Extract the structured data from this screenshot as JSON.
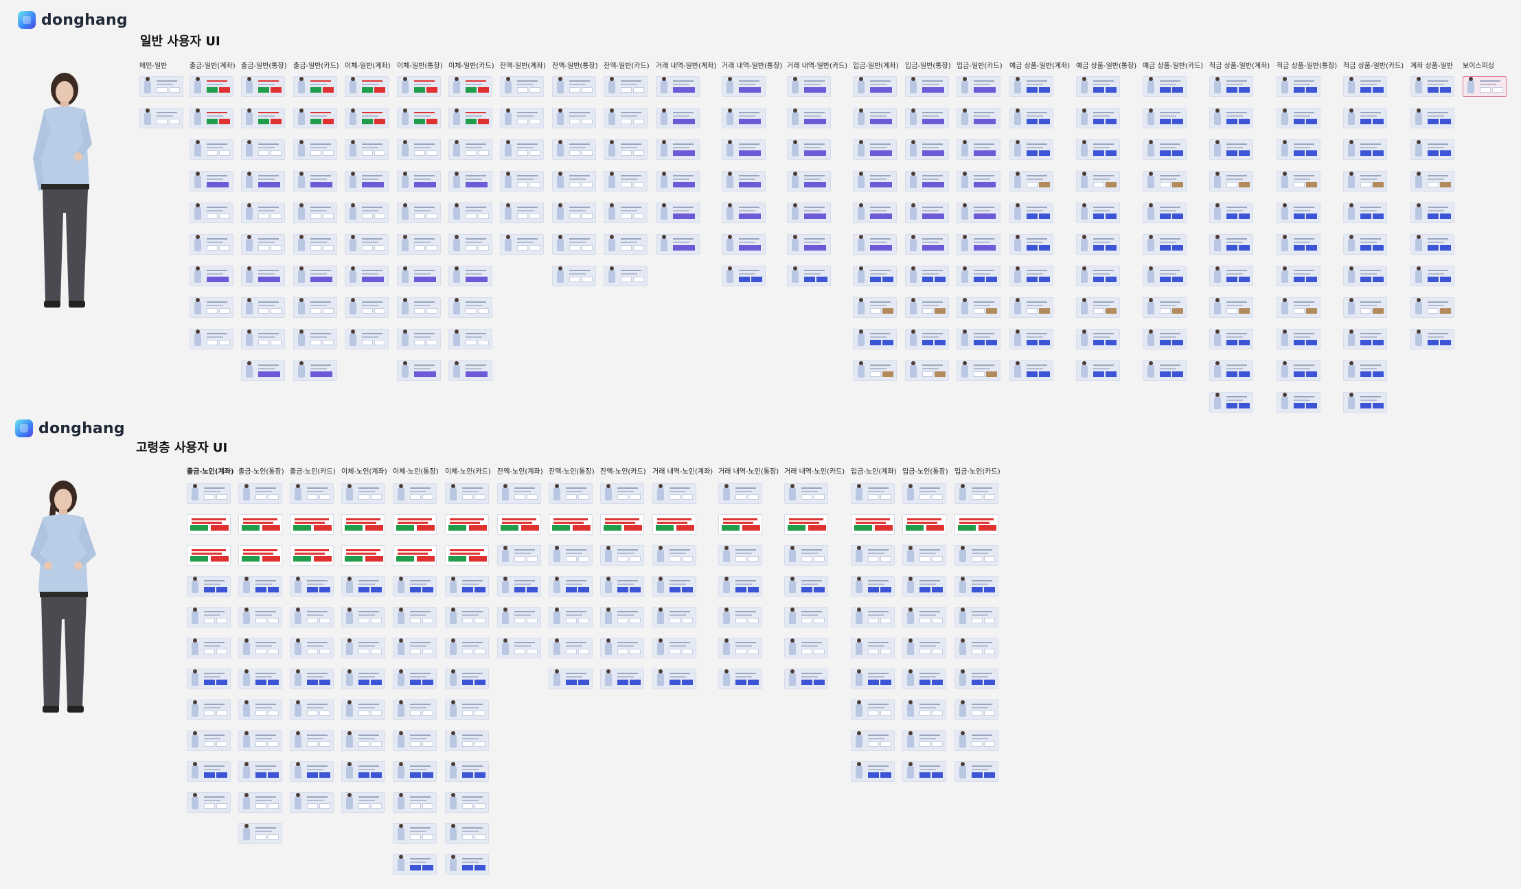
{
  "brand": {
    "name": "donghang"
  },
  "sections": [
    {
      "title": "일반 사용자 UI",
      "columns": [
        {
          "label": "메인-일반",
          "count": 2,
          "style": "plain"
        },
        {
          "label": "출금-일반(계좌)",
          "count": 9,
          "style": "red"
        },
        {
          "label": "출금-일반(통장)",
          "count": 10,
          "style": "red"
        },
        {
          "label": "출금-일반(카드)",
          "count": 10,
          "style": "red"
        },
        {
          "label": "이체-일반(계좌)",
          "count": 9,
          "style": "red"
        },
        {
          "label": "이체-일반(통장)",
          "count": 10,
          "style": "red"
        },
        {
          "label": "이체-일반(카드)",
          "count": 10,
          "style": "red"
        },
        {
          "label": "잔액-일반(계좌)",
          "count": 6,
          "style": "plain"
        },
        {
          "label": "잔액-일반(통장)",
          "count": 7,
          "style": "plain"
        },
        {
          "label": "잔액-일반(카드)",
          "count": 7,
          "style": "plain"
        },
        {
          "label": "거래 내역-일반(계좌)",
          "count": 6,
          "style": "purple"
        },
        {
          "label": "거래 내역-일반(통장)",
          "count": 7,
          "style": "purple"
        },
        {
          "label": "거래 내역-일반(카드)",
          "count": 7,
          "style": "purple"
        },
        {
          "label": "입금-일반(계좌)",
          "count": 10,
          "style": "purple"
        },
        {
          "label": "입금-일반(통장)",
          "count": 10,
          "style": "purple"
        },
        {
          "label": "입금-일반(카드)",
          "count": 10,
          "style": "purple"
        },
        {
          "label": "예금 상품-일반(계좌)",
          "count": 10,
          "style": "blue"
        },
        {
          "label": "예금 상품-일반(통장)",
          "count": 10,
          "style": "blue"
        },
        {
          "label": "예금 상품-일반(카드)",
          "count": 10,
          "style": "blue"
        },
        {
          "label": "적금 상품-일반(계좌)",
          "count": 11,
          "style": "blue"
        },
        {
          "label": "적금 상품-일반(통장)",
          "count": 11,
          "style": "blue"
        },
        {
          "label": "적금 상품-일반(카드)",
          "count": 11,
          "style": "blue"
        },
        {
          "label": "계좌 상품-일반",
          "count": 9,
          "style": "blue"
        },
        {
          "label": "보이스피싱",
          "count": 1,
          "style": "selected"
        }
      ]
    },
    {
      "title": "고령층 사용자 UI",
      "columns": [
        {
          "label": "출금-노인(계좌)",
          "count": 11,
          "style": "redbig"
        },
        {
          "label": "출금-노인(통장)",
          "count": 12,
          "style": "redbig"
        },
        {
          "label": "출금-노인(카드)",
          "count": 11,
          "style": "redbig"
        },
        {
          "label": "이체-노인(계좌)",
          "count": 11,
          "style": "redbig"
        },
        {
          "label": "이체-노인(통장)",
          "count": 13,
          "style": "redbig"
        },
        {
          "label": "이체-노인(카드)",
          "count": 13,
          "style": "redbig"
        },
        {
          "label": "잔액-노인(계좌)",
          "count": 6,
          "style": "redbig"
        },
        {
          "label": "잔액-노인(통장)",
          "count": 7,
          "style": "redbig"
        },
        {
          "label": "잔액-노인(카드)",
          "count": 7,
          "style": "redbig"
        },
        {
          "label": "거래 내역-노인(계좌)",
          "count": 7,
          "style": "redbig"
        },
        {
          "label": "거래 내역-노인(통장)",
          "count": 7,
          "style": "redbig"
        },
        {
          "label": "거래 내역-노인(카드)",
          "count": 7,
          "style": "redbig"
        },
        {
          "label": "입금-노인(계좌)",
          "count": 10,
          "style": "redbig"
        },
        {
          "label": "입금-노인(통장)",
          "count": 10,
          "style": "redbig"
        },
        {
          "label": "입금-노인(카드)",
          "count": 10,
          "style": "redbig"
        }
      ]
    }
  ],
  "colors": {
    "background": "#f3f3f4",
    "thumb": "#e4e9f4",
    "accent_blue": "#3b55d6",
    "accent_red": "#e03131",
    "accent_green": "#1f9d4a",
    "selected": "#e07a9a"
  }
}
